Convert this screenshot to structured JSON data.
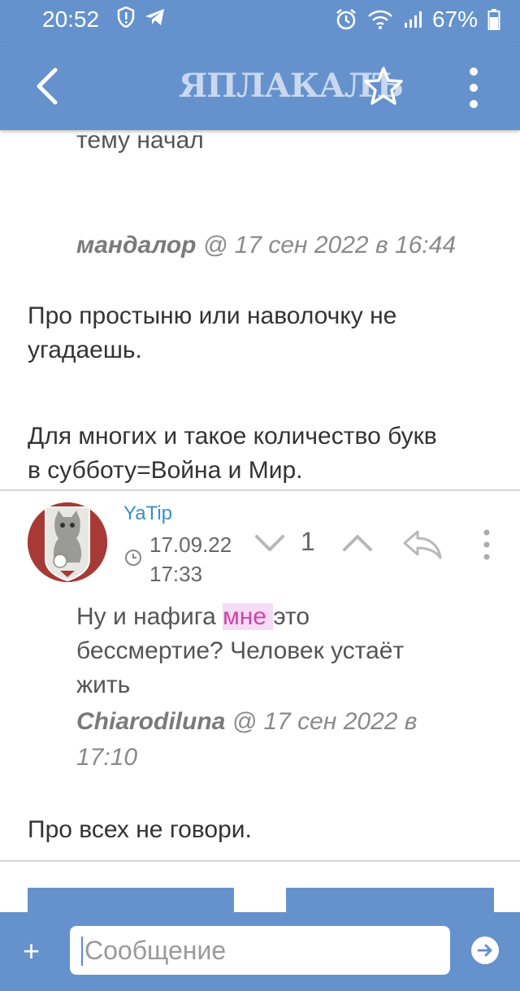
{
  "status_bar": {
    "time": "20:52",
    "battery": "67%"
  },
  "app_bar": {
    "logo": "ЯПЛАКАЛЪ",
    "back_icon": "chevron-left-icon",
    "star_icon": "star-outline-icon",
    "more_icon": "more-vertical-icon"
  },
  "post1": {
    "quote_text": "тему начал",
    "quote_author_name": "мандалор",
    "quote_author_meta": " @ 17 сен 2022 в 16:44",
    "body_line1": "Про простыню или наволочку не",
    "body_line2": "угадаешь.",
    "body_line3": "Для многих и такое количество букв",
    "body_line4": "в субботу=Война и Мир."
  },
  "post2": {
    "username": "YaTip",
    "date": "17.09.22",
    "time": "17:33",
    "vote_count": "1",
    "quote_line1_a": "Ну и нафига ",
    "quote_line1_b": "мне ",
    "quote_line1_c": "это",
    "quote_line2": "бессмертие? Человек устаёт",
    "quote_line3": "жить",
    "quote_author_name": "Chiarodiluna",
    "quote_author_meta": " @ 17 сен 2022 в",
    "quote_author_meta2": "17:10",
    "body": "Про всех не говори."
  },
  "composer": {
    "placeholder": "Сообщение",
    "plus_label": "+"
  },
  "colors": {
    "bar": "#6592cd",
    "link": "#3b8ec8"
  }
}
